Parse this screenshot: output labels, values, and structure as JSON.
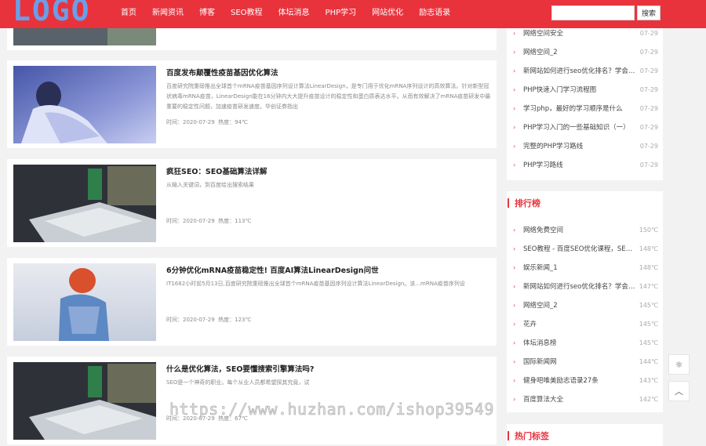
{
  "header": {
    "logo": "LOGO",
    "nav": [
      "首页",
      "新闻资讯",
      "博客",
      "SEO教程",
      "体坛消息",
      "PHP学习",
      "网站优化",
      "励志语录"
    ],
    "search_placeholder": "",
    "search_button": "搜索"
  },
  "articles": [
    {
      "title": "百度发布颠覆性疫苗基因优化算法",
      "desc": "百度研究院重磅推出全球首个mRNA疫苗基因序列设计算法LinearDesign，是专门用于优化mRNA序列设计的高效算法。针对新型冠状病毒mRNA疫苗，LinearDesign能在16分钟内大大提升疫苗设计的稳定性和蛋白质表达水平。从而有效解决了mRNA疫苗研发中最重要的稳定性问题，加速疫苗研发速度。华创证券指出",
      "time_label": "时间：",
      "time": "2020-07-29",
      "hot_label": "热度：",
      "hot": "94℃"
    },
    {
      "title": "疯狂SEO：SEO基础算法详解",
      "desc": "从输入关键词，到百度给出搜索结果",
      "time_label": "时间：",
      "time": "2020-07-29",
      "hot_label": "热度：",
      "hot": "113℃"
    },
    {
      "title": "6分钟优化mRNA疫苗稳定性! 百度AI算法LinearDesign问世",
      "desc": "IT1682小时前5月13日,百度研究院重磅推出全球首个mRNA疫苗基因序列设计算法LinearDesign。该...mRNA疫苗序列设",
      "time_label": "时间：",
      "time": "2020-07-29",
      "hot_label": "热度：",
      "hot": "123℃"
    },
    {
      "title": "什么是优化算法，SEO要懂搜索引擎算法吗?",
      "desc": "SEO是一个神奇的职业。每个从业人员都希望探其究竟，试",
      "time_label": "时间：",
      "time": "2020-07-29",
      "hot_label": "热度：",
      "hot": "67℃"
    }
  ],
  "latest": {
    "items": [
      {
        "name": "网络空间安全",
        "date": "07-29"
      },
      {
        "name": "网络空间_2",
        "date": "07-29"
      },
      {
        "name": "新网站如何进行seo优化排名？学会这几步",
        "date": "07-29"
      },
      {
        "name": "PHP快速入门学习流程图",
        "date": "07-29"
      },
      {
        "name": "学习php，最好的学习顺序是什么",
        "date": "07-29"
      },
      {
        "name": "PHP学习入门的一些基础知识（一）",
        "date": "07-29"
      },
      {
        "name": "完整的PHP学习路线",
        "date": "07-29"
      },
      {
        "name": "PHP学习路线",
        "date": "07-29"
      }
    ]
  },
  "ranking": {
    "title": "排行榜",
    "items": [
      {
        "name": "网络免费空间",
        "value": "150℃"
      },
      {
        "name": "SEO教程 - 百度SEO优化课程，SEO优化教程",
        "value": "148℃"
      },
      {
        "name": "娱乐新闻_1",
        "value": "148℃"
      },
      {
        "name": "新网站如何进行seo优化排名？学会这几步",
        "value": "147℃"
      },
      {
        "name": "网络空间_2",
        "value": "145℃"
      },
      {
        "name": "花卉",
        "value": "145℃"
      },
      {
        "name": "体坛消息榜",
        "value": "145℃"
      },
      {
        "name": "国际新闻网",
        "value": "144℃"
      },
      {
        "name": "健身吧唯美励志语录27条",
        "value": "143℃"
      },
      {
        "name": "百度算法大全",
        "value": "142℃"
      }
    ]
  },
  "tags": {
    "title": "热门标签"
  },
  "float_buttons": {
    "sun_icon": "☼",
    "top_icon": "︿"
  },
  "watermark": "https://www.huzhan.com/ishop39549",
  "colors": {
    "brand": "#e8333d",
    "logo": "#6b9ee8"
  }
}
